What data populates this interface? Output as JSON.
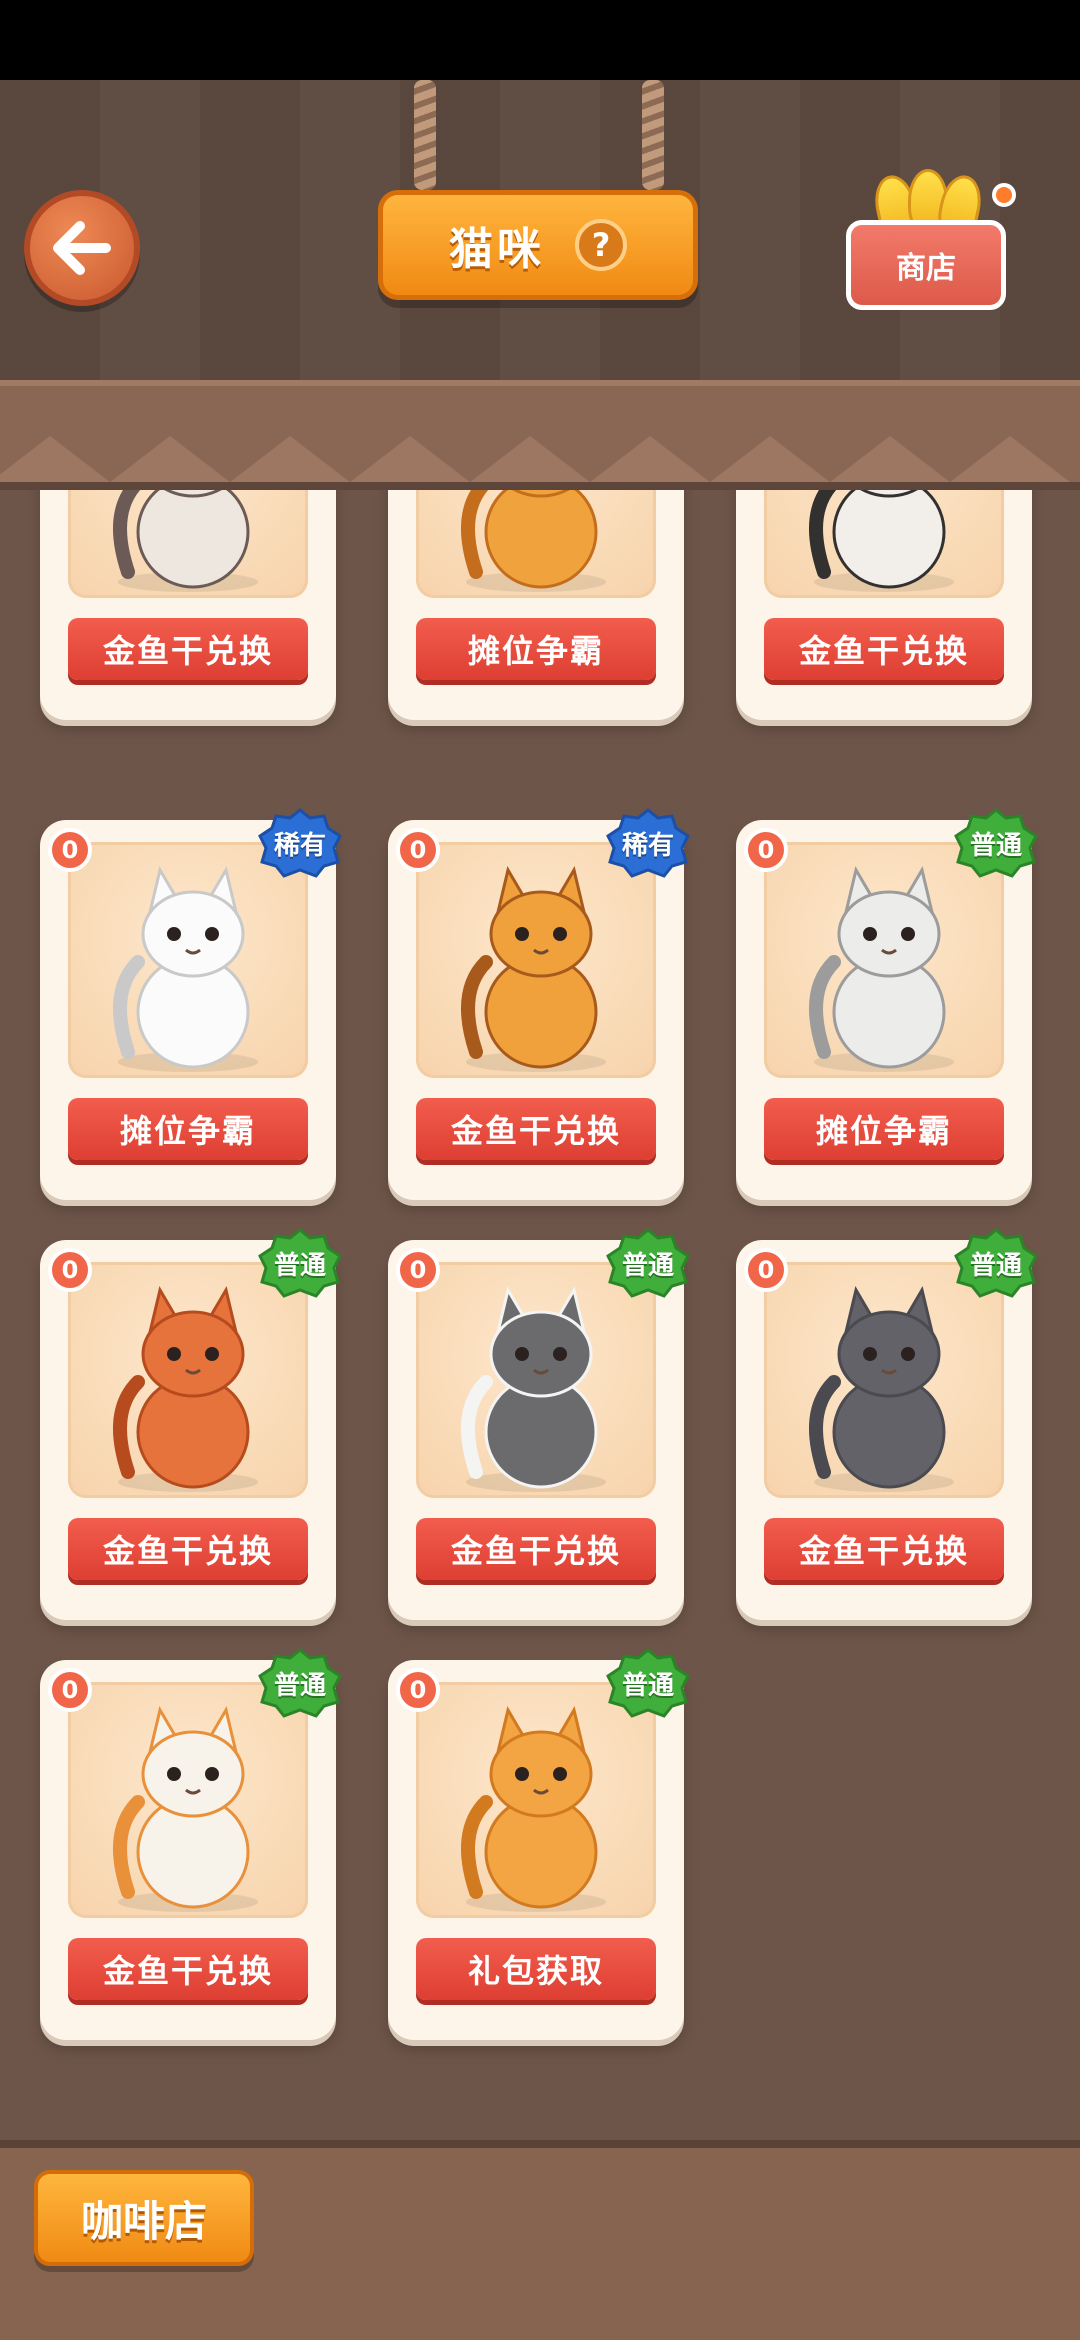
{
  "header": {
    "title": "猫咪",
    "help_icon": "?",
    "shop_label": "商店"
  },
  "colors": {
    "accent_orange": "#f08a13",
    "button_red": "#dd3f33",
    "rare_blue": "#2b6fd6",
    "common_green": "#3fae3a"
  },
  "cards": [
    {
      "button": "金鱼干兑换",
      "count": "",
      "rarity": "",
      "cat": "siamese-cat"
    },
    {
      "button": "摊位争霸",
      "count": "",
      "rarity": "",
      "cat": "orange-tabby-cat"
    },
    {
      "button": "金鱼干兑换",
      "count": "",
      "rarity": "",
      "cat": "black-white-cat"
    },
    {
      "button": "摊位争霸",
      "count": "0",
      "rarity": "稀有",
      "rarity_type": "rare",
      "cat": "white-odd-eye-cat"
    },
    {
      "button": "金鱼干兑换",
      "count": "0",
      "rarity": "稀有",
      "rarity_type": "rare",
      "cat": "tiger-stripe-cat"
    },
    {
      "button": "摊位争霸",
      "count": "0",
      "rarity": "普通",
      "rarity_type": "common",
      "cat": "scottish-fold-silver-cat"
    },
    {
      "button": "金鱼干兑换",
      "count": "0",
      "rarity": "普通",
      "rarity_type": "common",
      "cat": "ginger-cat"
    },
    {
      "button": "金鱼干兑换",
      "count": "0",
      "rarity": "普通",
      "rarity_type": "common",
      "cat": "grey-white-cat"
    },
    {
      "button": "金鱼干兑换",
      "count": "0",
      "rarity": "普通",
      "rarity_type": "common",
      "cat": "grey-fold-cat"
    },
    {
      "button": "金鱼干兑换",
      "count": "0",
      "rarity": "普通",
      "rarity_type": "common",
      "cat": "calico-cat"
    },
    {
      "button": "礼包获取",
      "count": "0",
      "rarity": "普通",
      "rarity_type": "common",
      "cat": "orange-striped-cat"
    }
  ],
  "footer": {
    "cafe_button": "咖啡店"
  }
}
